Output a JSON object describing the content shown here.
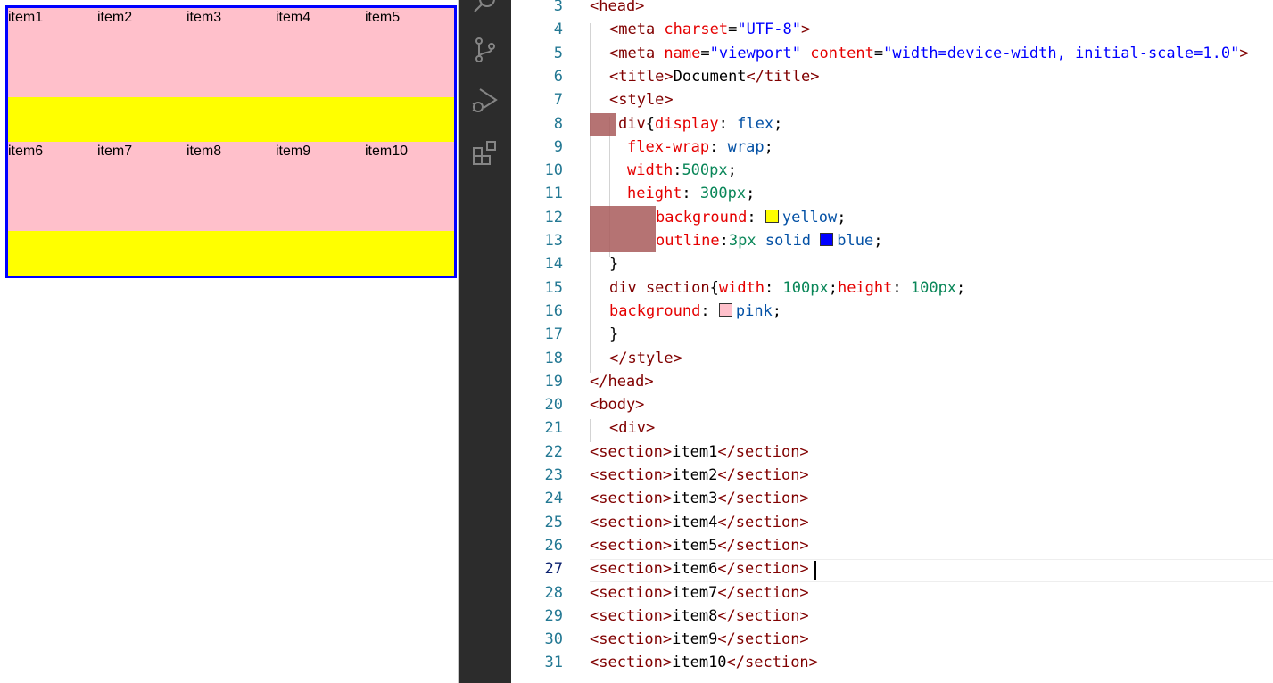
{
  "preview": {
    "items": [
      "item1",
      "item2",
      "item3",
      "item4",
      "item5",
      "item6",
      "item7",
      "item8",
      "item9",
      "item10"
    ]
  },
  "activity_bar": {
    "icons": [
      "search-icon",
      "source-control-icon",
      "run-debug-icon",
      "extensions-icon"
    ]
  },
  "editor": {
    "active_line": "27",
    "swatch_colors": {
      "yellow": "#ffff00",
      "blue": "#0000ff",
      "pink": "#ffc0cb"
    },
    "lines": [
      {
        "n": "3",
        "parts": [
          {
            "t": "<head>",
            "c": "tag"
          }
        ]
      },
      {
        "n": "4",
        "parts": [
          {
            "t": "<meta ",
            "c": "tag"
          },
          {
            "t": "charset",
            "c": "attr"
          },
          {
            "t": "=",
            "c": "txt"
          },
          {
            "t": "\"UTF-8\"",
            "c": "str"
          },
          {
            "t": ">",
            "c": "tag"
          }
        ]
      },
      {
        "n": "5",
        "parts": [
          {
            "t": "<meta ",
            "c": "tag"
          },
          {
            "t": "name",
            "c": "attr"
          },
          {
            "t": "=",
            "c": "txt"
          },
          {
            "t": "\"viewport\"",
            "c": "str"
          },
          {
            "t": " ",
            "c": "txt"
          },
          {
            "t": "content",
            "c": "attr"
          },
          {
            "t": "=",
            "c": "txt"
          },
          {
            "t": "\"width=device-width, initial-scale=1.0\"",
            "c": "str"
          },
          {
            "t": ">",
            "c": "tag"
          }
        ]
      },
      {
        "n": "6",
        "parts": [
          {
            "t": "<title>",
            "c": "tag"
          },
          {
            "t": "Document",
            "c": "txt"
          },
          {
            "t": "</title>",
            "c": "tag"
          }
        ]
      },
      {
        "n": "7",
        "parts": [
          {
            "t": "<style>",
            "c": "tag"
          }
        ]
      },
      {
        "n": "8",
        "parts": [
          {
            "t": "div",
            "c": "tag"
          },
          {
            "t": "{",
            "c": "txt"
          },
          {
            "t": "display",
            "c": "prop"
          },
          {
            "t": ": ",
            "c": "txt"
          },
          {
            "t": "flex",
            "c": "val"
          },
          {
            "t": ";",
            "c": "txt"
          }
        ]
      },
      {
        "n": "9",
        "parts": [
          {
            "t": "flex-wrap",
            "c": "prop"
          },
          {
            "t": ": ",
            "c": "txt"
          },
          {
            "t": "wrap",
            "c": "val"
          },
          {
            "t": ";",
            "c": "txt"
          }
        ]
      },
      {
        "n": "10",
        "parts": [
          {
            "t": "width",
            "c": "prop"
          },
          {
            "t": ":",
            "c": "txt"
          },
          {
            "t": "500px",
            "c": "num"
          },
          {
            "t": ";",
            "c": "txt"
          }
        ]
      },
      {
        "n": "11",
        "parts": [
          {
            "t": "height",
            "c": "prop"
          },
          {
            "t": ": ",
            "c": "txt"
          },
          {
            "t": "300px",
            "c": "num"
          },
          {
            "t": ";",
            "c": "txt"
          }
        ]
      },
      {
        "n": "12",
        "parts": [
          {
            "t": "background",
            "c": "prop"
          },
          {
            "t": ": ",
            "c": "txt"
          },
          {
            "t": "",
            "c": "swatch",
            "color": "yellow"
          },
          {
            "t": "yellow",
            "c": "val"
          },
          {
            "t": ";",
            "c": "txt"
          }
        ]
      },
      {
        "n": "13",
        "parts": [
          {
            "t": "outline",
            "c": "prop"
          },
          {
            "t": ":",
            "c": "txt"
          },
          {
            "t": "3px",
            "c": "num"
          },
          {
            "t": " solid ",
            "c": "val"
          },
          {
            "t": "",
            "c": "swatch",
            "color": "blue"
          },
          {
            "t": "blue",
            "c": "val"
          },
          {
            "t": ";",
            "c": "txt"
          }
        ]
      },
      {
        "n": "14",
        "parts": [
          {
            "t": "}",
            "c": "txt"
          }
        ]
      },
      {
        "n": "15",
        "parts": [
          {
            "t": "div section",
            "c": "tag"
          },
          {
            "t": "{",
            "c": "txt"
          },
          {
            "t": "width",
            "c": "prop"
          },
          {
            "t": ": ",
            "c": "txt"
          },
          {
            "t": "100px",
            "c": "num"
          },
          {
            "t": ";",
            "c": "txt"
          },
          {
            "t": "height",
            "c": "prop"
          },
          {
            "t": ": ",
            "c": "txt"
          },
          {
            "t": "100px",
            "c": "num"
          },
          {
            "t": ";",
            "c": "txt"
          }
        ]
      },
      {
        "n": "16",
        "parts": [
          {
            "t": "background",
            "c": "prop"
          },
          {
            "t": ": ",
            "c": "txt"
          },
          {
            "t": "",
            "c": "swatch",
            "color": "pink"
          },
          {
            "t": "pink",
            "c": "val"
          },
          {
            "t": ";",
            "c": "txt"
          }
        ]
      },
      {
        "n": "17",
        "parts": [
          {
            "t": "}",
            "c": "txt"
          }
        ]
      },
      {
        "n": "18",
        "parts": [
          {
            "t": "</style>",
            "c": "tag"
          }
        ]
      },
      {
        "n": "19",
        "parts": [
          {
            "t": "</head>",
            "c": "tag"
          }
        ]
      },
      {
        "n": "20",
        "parts": [
          {
            "t": "<body>",
            "c": "tag"
          }
        ]
      },
      {
        "n": "21",
        "parts": [
          {
            "t": "<div>",
            "c": "tag"
          }
        ]
      },
      {
        "n": "22",
        "parts": [
          {
            "t": "<section>",
            "c": "tag"
          },
          {
            "t": "item1",
            "c": "txt"
          },
          {
            "t": "</section>",
            "c": "tag"
          }
        ]
      },
      {
        "n": "23",
        "parts": [
          {
            "t": "<section>",
            "c": "tag"
          },
          {
            "t": "item2",
            "c": "txt"
          },
          {
            "t": "</section>",
            "c": "tag"
          }
        ]
      },
      {
        "n": "24",
        "parts": [
          {
            "t": "<section>",
            "c": "tag"
          },
          {
            "t": "item3",
            "c": "txt"
          },
          {
            "t": "</section>",
            "c": "tag"
          }
        ]
      },
      {
        "n": "25",
        "parts": [
          {
            "t": "<section>",
            "c": "tag"
          },
          {
            "t": "item4",
            "c": "txt"
          },
          {
            "t": "</section>",
            "c": "tag"
          }
        ]
      },
      {
        "n": "26",
        "parts": [
          {
            "t": "<section>",
            "c": "tag"
          },
          {
            "t": "item5",
            "c": "txt"
          },
          {
            "t": "</section>",
            "c": "tag"
          }
        ]
      },
      {
        "n": "27",
        "parts": [
          {
            "t": "<section>",
            "c": "tag"
          },
          {
            "t": "item6",
            "c": "txt"
          },
          {
            "t": "</section>",
            "c": "tag"
          }
        ]
      },
      {
        "n": "28",
        "parts": [
          {
            "t": "<section>",
            "c": "tag"
          },
          {
            "t": "item7",
            "c": "txt"
          },
          {
            "t": "</section>",
            "c": "tag"
          }
        ]
      },
      {
        "n": "29",
        "parts": [
          {
            "t": "<section>",
            "c": "tag"
          },
          {
            "t": "item8",
            "c": "txt"
          },
          {
            "t": "</section>",
            "c": "tag"
          }
        ]
      },
      {
        "n": "30",
        "parts": [
          {
            "t": "<section>",
            "c": "tag"
          },
          {
            "t": "item9",
            "c": "txt"
          },
          {
            "t": "</section>",
            "c": "tag"
          }
        ]
      },
      {
        "n": "31",
        "parts": [
          {
            "t": "<section>",
            "c": "tag"
          },
          {
            "t": "item10",
            "c": "txt"
          },
          {
            "t": "</section>",
            "c": "tag"
          }
        ]
      }
    ]
  }
}
